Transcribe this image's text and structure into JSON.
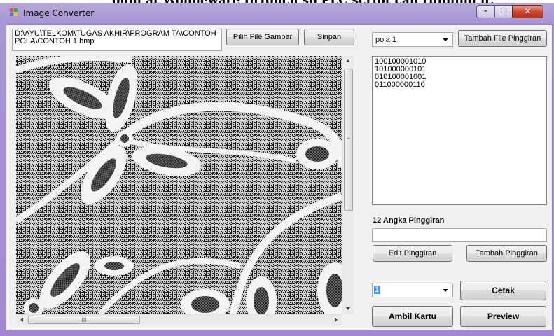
{
  "background_caption": "ouid at Wondeware InTouch so PLC script can running it.",
  "window": {
    "title": "Image Converter",
    "minimize_glyph": "–",
    "maximize_glyph": "☐",
    "close_glyph": "✕"
  },
  "file": {
    "path": "D:\\AYU\\TELKOM\\TUGAS AKHIR\\PROGRAM TA\\CONTOH POLA\\CONTOH 1.bmp",
    "pick_button": "Pilih File Gambar",
    "save_button": "Sinpan"
  },
  "pattern_combo": {
    "selected": "pola 1"
  },
  "add_border_file_button": "Tambah File Pinggiran",
  "border_list": [
    "100100001010",
    "101000000101",
    "010100001001",
    "011000000110"
  ],
  "border_digits": {
    "label": "12 Angka Pinggiran",
    "value": ""
  },
  "edit_border_button": "Edit Pinggiran",
  "add_border_button": "Tambah Pinggiran",
  "count_combo": {
    "selected": "1"
  },
  "print_button": "Cetak",
  "take_card_button": "Ambil Kartu",
  "preview_button": "Preview",
  "scrollbar": {
    "h_grip": "III",
    "v_grip": "≡"
  },
  "colors": {
    "title_gradient": "#a894d3",
    "client_bg": "#f0f0f0",
    "close_red": "#c9432c"
  },
  "icons": {
    "app": "app-window-icon",
    "minimize": "minimize-icon",
    "maximize": "maximize-icon",
    "close": "close-icon"
  }
}
